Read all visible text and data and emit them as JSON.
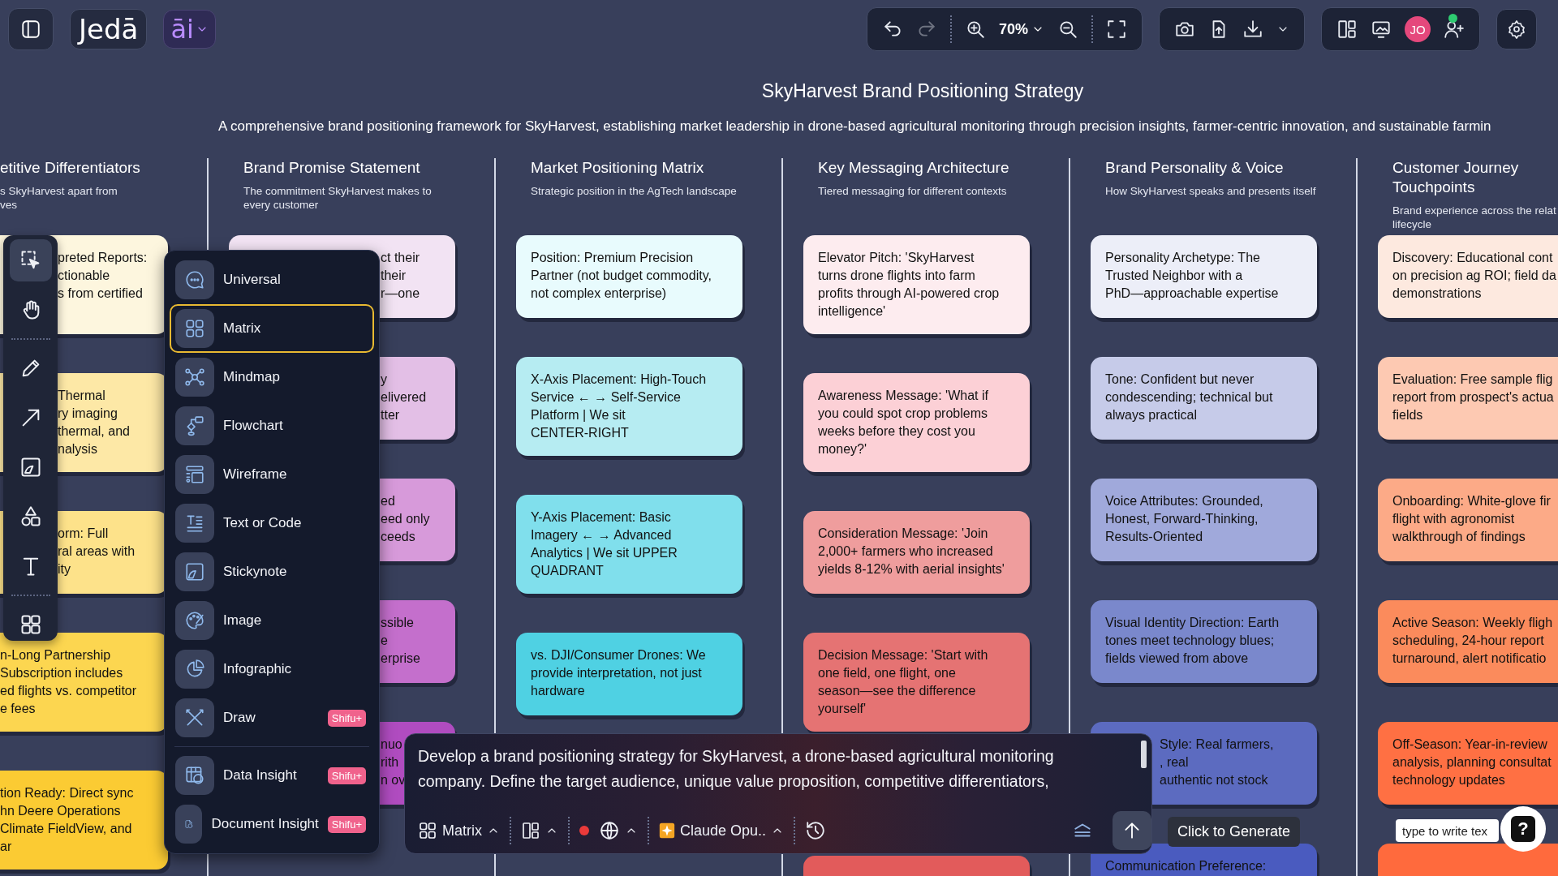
{
  "topbar": {
    "logo": "Jedā",
    "ai_label": "āi",
    "zoom": "70%",
    "redo_disabled": true,
    "avatar": "JO",
    "avatar_online": true
  },
  "board": {
    "title": "SkyHarvest Brand Positioning Strategy",
    "subtitle": "A comprehensive brand positioning framework for SkyHarvest, establishing market leadership in drone-based agricultural monitoring through precision insights, farmer-centric innovation, and sustainable farmin",
    "columns": [
      {
        "title": [
          "etitive Differentiators"
        ],
        "subtitle": [
          "s SkyHarvest apart from",
          "ves"
        ],
        "cards": [
          {
            "lines": [
              "preted Reports:",
              "ctionable",
              "s from certified"
            ],
            "color": "#fdf6de"
          },
          {
            "lines": [
              "Thermal",
              "ry imaging",
              "thermal, and",
              "nalysis"
            ],
            "color": "#fde8a6"
          },
          {
            "lines": [
              "orm: Full",
              "ral areas with",
              "ity"
            ],
            "color": "#fde28a"
          },
          {
            "lines": [
              "n-Long Partnership",
              "Subscription includes",
              "ed flights vs. competitor",
              "e fees"
            ],
            "color": "#fcd650"
          },
          {
            "lines": [
              "tion Ready: Direct sync",
              "hn Deere Operations",
              "Climate FieldView, and",
              "ar"
            ],
            "color": "#fbcb33"
          }
        ]
      },
      {
        "title": [
          "Brand Promise Statement"
        ],
        "subtitle": [
          "The commitment SkyHarvest makes to",
          "every customer"
        ],
        "cards": [
          {
            "lines": [
              "ct their",
              "their",
              "r—one"
            ],
            "color": "#f2e3f3"
          },
          {
            "lines": [
              "y",
              "elivered",
              "tter"
            ],
            "color": "#e3bfe6"
          },
          {
            "lines": [
              "ed",
              "eed only",
              "ceeds"
            ],
            "color": "#d79ada"
          },
          {
            "lines": [
              "ssible",
              "e",
              "erprise"
            ],
            "color": "#c46fcc"
          },
          {
            "lines": [
              "nuo",
              "rith",
              "n ov"
            ],
            "color": "#b04cc0"
          }
        ]
      },
      {
        "title": [
          "Market Positioning Matrix"
        ],
        "subtitle": [
          "Strategic position in the AgTech landscape"
        ],
        "cards": [
          {
            "lines": [
              "Position: Premium Precision",
              "Partner (not budget commodity,",
              "not complex enterprise)"
            ],
            "color": "#e8fbfd"
          },
          {
            "lines": [
              "X-Axis Placement: High-Touch",
              "Service ← → Self-Service",
              "Platform | We sit",
              "CENTER-RIGHT"
            ],
            "color": "#b6ecf2"
          },
          {
            "lines": [
              "Y-Axis Placement: Basic",
              "Imagery ← → Advanced",
              "Analytics | We sit UPPER",
              "QUADRANT"
            ],
            "color": "#80dfec"
          },
          {
            "lines": [
              "vs. DJI/Consumer Drones: We",
              "provide interpretation, not just",
              "hardware"
            ],
            "color": "#4fd1e3"
          }
        ]
      },
      {
        "title": [
          "Key Messaging Architecture"
        ],
        "subtitle": [
          "Tiered messaging for different contexts"
        ],
        "cards": [
          {
            "lines": [
              "Elevator Pitch: 'SkyHarvest",
              "turns drone flights into farm",
              "profits through AI-powered crop",
              "intelligence'"
            ],
            "color": "#fdecef"
          },
          {
            "lines": [
              "Awareness Message: 'What if",
              "you could spot crop problems",
              "weeks before they cost you",
              "money?'"
            ],
            "color": "#fcd0d6"
          },
          {
            "lines": [
              "Consideration Message: 'Join",
              "2,000+ farmers who increased",
              "yields 8-12% with aerial insights'"
            ],
            "color": "#ef9d9d"
          },
          {
            "lines": [
              "Decision Message: 'Start with",
              "one field, one flight, one",
              "season—see the difference",
              "yourself'"
            ],
            "color": "#e57373"
          },
          {
            "color": "#e25b5b"
          }
        ]
      },
      {
        "title": [
          "Brand Personality & Voice"
        ],
        "subtitle": [
          "How SkyHarvest speaks and presents itself"
        ],
        "cards": [
          {
            "lines": [
              "Personality Archetype: The",
              "Trusted Neighbor with a",
              "PhD—approachable expertise"
            ],
            "color": "#eceef8"
          },
          {
            "lines": [
              "Tone: Confident but never",
              "condescending; technical but",
              "always practical"
            ],
            "color": "#c6cbe9"
          },
          {
            "lines": [
              "Voice Attributes: Grounded,",
              "Honest, Forward-Thinking,",
              "Results-Oriented"
            ],
            "color": "#a0a9db"
          },
          {
            "lines": [
              "Visual Identity Direction: Earth",
              "tones meet technology blues;",
              "fields viewed from above"
            ],
            "color": "#7a88cc"
          },
          {
            "lines": [
              "Style: Real farmers,",
              ", real",
              "authentic not stock"
            ],
            "color": "#5c6bc0"
          },
          {
            "lines": [
              "Communication Preference:"
            ],
            "color": "#4a5bbf"
          }
        ]
      },
      {
        "title": [
          "Customer Journey",
          "Touchpoints"
        ],
        "subtitle": [
          "Brand experience across the relat",
          "lifecycle"
        ],
        "cards": [
          {
            "lines": [
              "Discovery: Educational cont",
              "on precision ag ROI; field da",
              "demonstrations"
            ],
            "color": "#fde9df"
          },
          {
            "lines": [
              "Evaluation: Free sample flig",
              "report from prospect's actua",
              "fields"
            ],
            "color": "#fdc9b2"
          },
          {
            "lines": [
              "Onboarding: White-glove fir",
              "flight with agronomist",
              "walkthrough of findings"
            ],
            "color": "#fcaa87"
          },
          {
            "lines": [
              "Active Season: Weekly fligh",
              "scheduling, 24-hour report",
              "turnaround, alert notificatio"
            ],
            "color": "#fb8b5c"
          },
          {
            "lines": [
              "Off-Season: Year-in-review",
              "analysis, planning consultat",
              "technology updates"
            ],
            "color": "#ff7043"
          },
          {
            "color": "#ff6a3d"
          }
        ]
      }
    ]
  },
  "tool_groups": [
    {
      "tools": [
        {
          "kind": "select",
          "selected": true
        },
        {
          "kind": "hand",
          "selected": false
        }
      ]
    },
    {
      "tools": [
        {
          "kind": "pencil",
          "selected": false
        },
        {
          "kind": "arrow",
          "selected": false
        },
        {
          "kind": "sticky",
          "selected": false
        },
        {
          "kind": "shapes",
          "selected": false
        },
        {
          "kind": "text",
          "selected": false
        }
      ]
    },
    {
      "tools": [
        {
          "kind": "grid",
          "selected": false
        }
      ]
    }
  ],
  "create_menu": {
    "groups": [
      {
        "items": [
          {
            "kind": "universal",
            "label": "Universal",
            "selected": false
          },
          {
            "kind": "matrix",
            "label": "Matrix",
            "selected": true
          },
          {
            "kind": "mindmap",
            "label": "Mindmap",
            "selected": false
          },
          {
            "kind": "flowchart",
            "label": "Flowchart",
            "selected": false
          },
          {
            "kind": "wireframe",
            "label": "Wireframe",
            "selected": false
          },
          {
            "kind": "text",
            "label": "Text or Code",
            "selected": false
          },
          {
            "kind": "stickynote",
            "label": "Stickynote",
            "selected": false
          },
          {
            "kind": "image",
            "label": "Image",
            "selected": false
          },
          {
            "kind": "infographic",
            "label": "Infographic",
            "selected": false
          },
          {
            "kind": "draw",
            "label": "Draw",
            "selected": false,
            "badge": "Shifu+"
          }
        ]
      },
      {
        "items": [
          {
            "kind": "data",
            "label": "Data Insight",
            "selected": false,
            "badge": "Shifu+"
          },
          {
            "kind": "document",
            "label": "Document Insight",
            "selected": false,
            "badge": "Shifu+"
          }
        ]
      }
    ]
  },
  "prompt": {
    "lines": [
      "Develop a brand positioning strategy for SkyHarvest, a drone-based agricultural monitoring",
      "company. Define the target audience, unique value proposition, competitive differentiators,"
    ],
    "mode": "Matrix",
    "model": "Claude Opu.."
  },
  "tooltip": "Click to Generate",
  "note_field": {
    "placeholder": "type to write tex"
  },
  "help_label": "?"
}
